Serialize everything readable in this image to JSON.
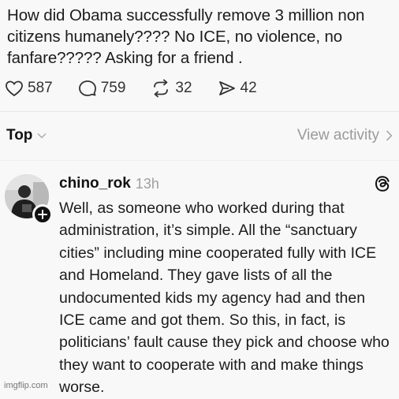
{
  "post": {
    "text": "How did Obama successfully remove 3 million non citizens humanely???? No ICE, no violence, no fanfare????? Asking for a friend ."
  },
  "actions": {
    "likes": "587",
    "comments": "759",
    "reposts": "32",
    "shares": "42"
  },
  "sort": {
    "label": "Top",
    "view_activity": "View activity"
  },
  "reply": {
    "username": "chino_rok",
    "time": "13h",
    "text": "Well, as someone who worked during that administration, it’s simple. All the “sanctuary cities” including mine cooperated fully with ICE and Homeland. They gave lists of all the undocumented kids my agency had and then ICE came and got them. So this, in fact, is politicians’ fault cause they pick and choose who they want to cooperate with and make things worse."
  },
  "watermark": "imgflip.com",
  "icons": {
    "like": "heart-icon",
    "comment": "comment-icon",
    "repost": "repost-icon",
    "share": "share-icon",
    "sort_chevron": "chevron-down-icon",
    "view_chevron": "chevron-right-icon",
    "platform": "threads-logo-icon",
    "follow": "plus-icon"
  }
}
